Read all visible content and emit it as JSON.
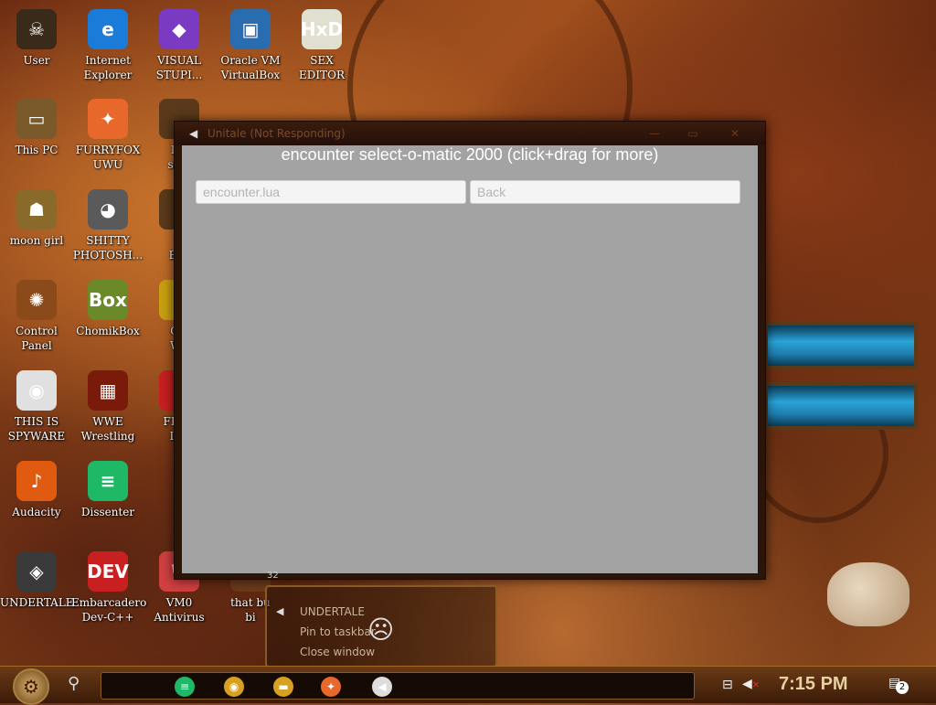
{
  "desktop_icons": [
    {
      "label_line1": "User",
      "label_line2": "",
      "glyph": "☠",
      "color": "#3a2a1a"
    },
    {
      "label_line1": "Internet",
      "label_line2": "Explorer",
      "glyph": "e",
      "color": "#1a7cd8"
    },
    {
      "label_line1": "VISUAL",
      "label_line2": "STUPI...",
      "glyph": "◆",
      "color": "#7a3bc2"
    },
    {
      "label_line1": "Oracle VM",
      "label_line2": "VirtualBox",
      "glyph": "▣",
      "color": "#2a6cb0"
    },
    {
      "label_line1": "SEX",
      "label_line2": "EDITOR",
      "glyph": "HxD",
      "color": "#e0e0d0"
    },
    {
      "label_line1": "This PC",
      "label_line2": "",
      "glyph": "▭",
      "color": "#7a5a2a"
    },
    {
      "label_line1": "FURRYFOX",
      "label_line2": "UWU",
      "glyph": "✦",
      "color": "#e8672a"
    },
    {
      "label_line1": "moon girl",
      "label_line2": "",
      "glyph": "☗",
      "color": "#8a6a2a"
    },
    {
      "label_line1": "SHITTY",
      "label_line2": "PHOTOSH...",
      "glyph": "◕",
      "color": "#5a5a5a"
    },
    {
      "label_line1": "Control Panel",
      "label_line2": "",
      "glyph": "✺",
      "color": "#8a4a1a"
    },
    {
      "label_line1": "ChomikBox",
      "label_line2": "",
      "glyph": "Box",
      "color": "#6a8a2a"
    },
    {
      "label_line1": "THIS IS",
      "label_line2": "SPYWARE",
      "glyph": "◉",
      "color": "#e0e0e0"
    },
    {
      "label_line1": "WWE",
      "label_line2": "Wrestling",
      "glyph": "▦",
      "color": "#7a1a0a"
    },
    {
      "label_line1": "Audacity",
      "label_line2": "",
      "glyph": "♪",
      "color": "#e05a10"
    },
    {
      "label_line1": "Dissenter",
      "label_line2": "",
      "glyph": "≡",
      "color": "#1fb866"
    },
    {
      "label_line1": "UNDERTALE",
      "label_line2": "",
      "glyph": "◈",
      "color": "#3a3a3a"
    },
    {
      "label_line1": "Embarcadero",
      "label_line2": "Dev-C++",
      "glyph": "DEV",
      "color": "#c82020"
    },
    {
      "label_line1": "VM0",
      "label_line2": "Antivirus",
      "glyph": "⛨",
      "color": "#d04040"
    },
    {
      "label_line1": "that bu",
      "label_line2": "bi",
      "glyph": "",
      "color": "#6a3a1a"
    },
    {
      "label_line1": "loc",
      "label_line2": "skid",
      "glyph": "",
      "color": "#5a3a1a"
    },
    {
      "label_line1": "N",
      "label_line2": "Bac",
      "glyph": "",
      "color": "#5a3a1a"
    },
    {
      "label_line1": "GO",
      "label_line2": "Wh",
      "glyph": "",
      "color": "#c8a010"
    },
    {
      "label_line1": "FREE",
      "label_line2": "IFT",
      "glyph": "",
      "color": "#c82020"
    }
  ],
  "window": {
    "title": "Unitale (Not Responding)",
    "minimize": "—",
    "maximize": "▭",
    "close": "✕",
    "heading": "encounter select-o-matic 2000 (click+drag for more)",
    "buttons": [
      {
        "label": "encounter.lua"
      },
      {
        "label": "Back"
      }
    ]
  },
  "preview": {
    "badge": "32",
    "items": [
      "UNDERTALE",
      "Pin to taskbar",
      "Close window"
    ],
    "sad_face": "☹"
  },
  "taskbar": {
    "start_glyph": "⚙",
    "search_glyph": "⚲",
    "apps": [
      {
        "name": "dissenter",
        "glyph": "≡",
        "color": "#1fb866"
      },
      {
        "name": "chrome",
        "glyph": "◉",
        "color": "#d8a020"
      },
      {
        "name": "explorer",
        "glyph": "▬",
        "color": "#d8a020"
      },
      {
        "name": "firefox",
        "glyph": "✦",
        "color": "#e8672a"
      },
      {
        "name": "unitale",
        "glyph": "◀",
        "color": "#dddddd"
      }
    ],
    "clock": "7:15 PM",
    "notification_count": "2"
  }
}
